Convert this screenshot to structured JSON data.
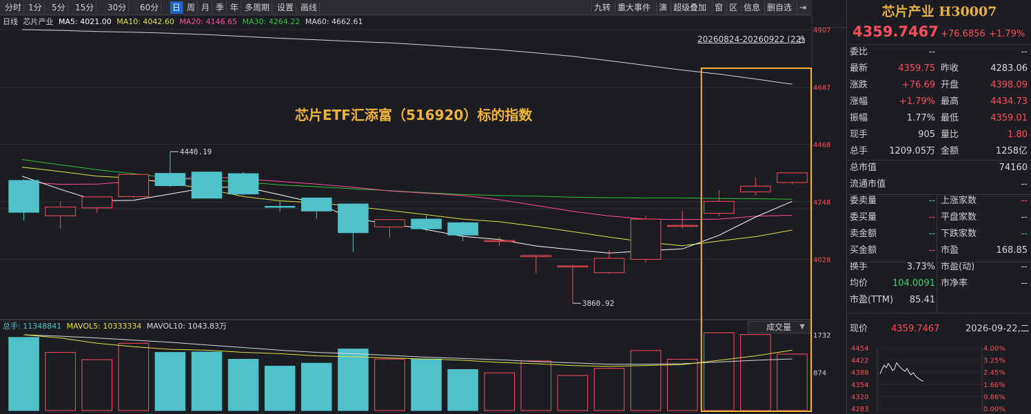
{
  "toolbar": {
    "periods": [
      "分时",
      "1分",
      "5分",
      "15分",
      "30分",
      "60分",
      "日",
      "周",
      "月",
      "季",
      "年",
      "多周期",
      "设置",
      "画线"
    ],
    "active_period": "日",
    "right_buttons": [
      "九转",
      "重大事件",
      "演",
      "超级叠加",
      "窗",
      "区",
      "信息",
      "删自选"
    ]
  },
  "indicator": {
    "period_label": "日线",
    "name": "芯片产业",
    "ma5": "MA5: 4021.00",
    "ma10": "MA10: 4042.60",
    "ma20": "MA20: 4146.65",
    "ma30": "MA30: 4264.22",
    "ma60": "MA60: 4662.61"
  },
  "volume_indicator": {
    "total": "总手: 11348841",
    "mavol5": "MAVOL5: 10333334",
    "mavol10": "MAVOL10: 1043.83万"
  },
  "volume_select": "成交量",
  "range_label": "20260824-20260922 (22)",
  "annotation": "芯片ETF汇添富（516920）标的指数",
  "price_axis": [
    "4907",
    "4687",
    "4468",
    "4248",
    "4028"
  ],
  "volume_axis": [
    "1732",
    "874"
  ],
  "marks": {
    "high": "4440.19",
    "low": "3860.92"
  },
  "colors": {
    "up": "#ff4d5a",
    "down": "#4fc1c9",
    "ma5": "#ffffff",
    "ma10": "#e5e04a",
    "ma20": "#ff4fa0",
    "ma30": "#35c23d",
    "ma60": "#d8d8d8",
    "highlight": "#f0b43a"
  },
  "chart_data": {
    "type": "candlestick",
    "ylim": [
      3800,
      4907
    ],
    "candles": [
      {
        "o": 4330,
        "h": 4335,
        "l": 4176,
        "c": 4208
      },
      {
        "o": 4195,
        "h": 4250,
        "l": 4145,
        "c": 4228
      },
      {
        "o": 4225,
        "h": 4262,
        "l": 4205,
        "c": 4267
      },
      {
        "o": 4268,
        "h": 4335,
        "l": 4262,
        "c": 4353
      },
      {
        "o": 4357,
        "h": 4440,
        "l": 4305,
        "c": 4310
      },
      {
        "o": 4362,
        "h": 4362,
        "l": 4262,
        "c": 4262
      },
      {
        "o": 4356,
        "h": 4362,
        "l": 4273,
        "c": 4278
      },
      {
        "o": 4231,
        "h": 4253,
        "l": 4211,
        "c": 4229
      },
      {
        "o": 4263,
        "h": 4263,
        "l": 4184,
        "c": 4213
      },
      {
        "o": 4240,
        "h": 4242,
        "l": 4056,
        "c": 4130
      },
      {
        "o": 4152,
        "h": 4172,
        "l": 4111,
        "c": 4180
      },
      {
        "o": 4182,
        "h": 4197,
        "l": 4136,
        "c": 4145
      },
      {
        "o": 4168,
        "h": 4172,
        "l": 4098,
        "c": 4121
      },
      {
        "o": 4098,
        "h": 4114,
        "l": 4080,
        "c": 4100
      },
      {
        "o": 4038,
        "h": 4046,
        "l": 3975,
        "c": 4043
      },
      {
        "o": 4000,
        "h": 4007,
        "l": 3860,
        "c": 4003
      },
      {
        "o": 3977,
        "h": 4063,
        "l": 3972,
        "c": 4032
      },
      {
        "o": 4028,
        "h": 4195,
        "l": 4016,
        "c": 4182
      },
      {
        "o": 4155,
        "h": 4213,
        "l": 4146,
        "c": 4158
      },
      {
        "o": 4204,
        "h": 4292,
        "l": 4193,
        "c": 4250
      },
      {
        "o": 4286,
        "h": 4340,
        "l": 4273,
        "c": 4308
      },
      {
        "o": 4322,
        "h": 4351,
        "l": 4314,
        "c": 4359
      }
    ],
    "ma5": [
      4346,
      4296,
      4252,
      4254,
      4278,
      4302,
      4306,
      4275,
      4243,
      4183,
      4165,
      4142,
      4116,
      4104,
      4079,
      4065,
      4052,
      4061,
      4068,
      4120,
      4190,
      4250
    ],
    "ma10": [
      4381,
      4364,
      4346,
      4339,
      4318,
      4298,
      4268,
      4252,
      4244,
      4231,
      4215,
      4199,
      4182,
      4172,
      4154,
      4134,
      4113,
      4094,
      4080,
      4098,
      4115,
      4140
    ],
    "ma20": [
      4325,
      4315,
      4316,
      4326,
      4333,
      4345,
      4336,
      4326,
      4316,
      4304,
      4290,
      4281,
      4272,
      4256,
      4234,
      4212,
      4194,
      4182,
      4180,
      4182,
      4193,
      4197
    ],
    "ma30": [
      4410,
      4390,
      4371,
      4356,
      4339,
      4331,
      4324,
      4313,
      4306,
      4298,
      4291,
      4283,
      4276,
      4272,
      4270,
      4266,
      4264,
      4263,
      4263,
      4261,
      4260,
      4258
    ],
    "ma60": [
      4907,
      4904,
      4900,
      4897,
      4893,
      4888,
      4881,
      4874,
      4868,
      4862,
      4856,
      4848,
      4839,
      4830,
      4818,
      4805,
      4788,
      4770,
      4752,
      4737,
      4718,
      4698
    ],
    "volume": {
      "ylim": [
        0,
        1732
      ],
      "values": [
        1672,
        1329,
        1164,
        1537,
        1329,
        1338,
        1173,
        1016,
        1083,
        1407,
        1178,
        1178,
        938,
        862,
        1135,
        801,
        964,
        1373,
        1173,
        1819,
        1737,
        1290
      ],
      "mavol5": [
        1732,
        1660,
        1540,
        1460,
        1400,
        1380,
        1330,
        1300,
        1250,
        1230,
        1200,
        1180,
        1150,
        1100,
        1070,
        1030,
        1010,
        1030,
        1050,
        1150,
        1250,
        1380
      ],
      "mavol10": [
        1732,
        1700,
        1660,
        1610,
        1560,
        1500,
        1440,
        1380,
        1330,
        1300,
        1260,
        1220,
        1190,
        1160,
        1120,
        1090,
        1060,
        1060,
        1070,
        1110,
        1150,
        1180
      ]
    },
    "highlight_from_index": 19
  },
  "quote": {
    "title": "芯片产业 H30007",
    "price": "4359.7467",
    "change": "+76.6856",
    "change_pct": "+1.79%",
    "rows": [
      {
        "l1": "委比",
        "v1": "--",
        "c1": "white",
        "l2": "",
        "v2": "--",
        "c2": "white"
      },
      {
        "l1": "最新",
        "v1": "4359.75",
        "c1": "red",
        "l2": "昨收",
        "v2": "4283.06",
        "c2": "white"
      },
      {
        "l1": "涨跌",
        "v1": "+76.69",
        "c1": "red",
        "l2": "开盘",
        "v2": "4398.09",
        "c2": "red"
      },
      {
        "l1": "涨幅",
        "v1": "+1.79%",
        "c1": "red",
        "l2": "最高",
        "v2": "4434.73",
        "c2": "red"
      },
      {
        "l1": "振幅",
        "v1": "1.77%",
        "c1": "white",
        "l2": "最低",
        "v2": "4359.01",
        "c2": "red"
      },
      {
        "l1": "现手",
        "v1": "905",
        "c1": "white",
        "l2": "量比",
        "v2": "1.80",
        "c2": "red"
      },
      {
        "l1": "总手",
        "v1": "1209.05万",
        "c1": "white",
        "l2": "金额",
        "v2": "1258亿",
        "c2": "white"
      },
      {
        "l1": "总市值",
        "v1": "",
        "c1": "white",
        "l2": "",
        "v2": "74160",
        "c2": "white"
      },
      {
        "l1": "流通市值",
        "v1": "",
        "c1": "white",
        "l2": "",
        "v2": "--",
        "c2": "white"
      },
      {
        "l1": "委卖量",
        "v1": "--",
        "c1": "cyan",
        "l2": "上涨家数",
        "v2": "--",
        "c2": "red"
      },
      {
        "l1": "委买量",
        "v1": "--",
        "c1": "red",
        "l2": "平盘家数",
        "v2": "--",
        "c2": "white"
      },
      {
        "l1": "卖金额",
        "v1": "--",
        "c1": "cyan",
        "l2": "下跌家数",
        "v2": "--",
        "c2": "green"
      },
      {
        "l1": "买金额",
        "v1": "--",
        "c1": "red",
        "l2": "市盈",
        "v2": "168.85",
        "c2": "white"
      },
      {
        "l1": "换手",
        "v1": "3.73%",
        "c1": "white",
        "l2": "市盈(动)",
        "v2": "--",
        "c2": "white"
      },
      {
        "l1": "均价",
        "v1": "104.0091",
        "c1": "green",
        "l2": "市净率",
        "v2": "--",
        "c2": "white"
      },
      {
        "l1": "市盈(TTM)",
        "v1": "85.41",
        "c1": "white",
        "l2": "",
        "v2": "",
        "c2": "white"
      }
    ],
    "bottom": {
      "label": "现价",
      "price": "4359.7467",
      "date": "2026-09-22,二",
      "price_axis": [
        "4454",
        "4422",
        "4388",
        "4354",
        "4320",
        "4283"
      ],
      "pct_axis": [
        "4.00%",
        "3.25%",
        "2.45%",
        "1.66%",
        "0.86%",
        "0.00%"
      ],
      "intraday": [
        4380,
        4395,
        4405,
        4398,
        4410,
        4402,
        4390,
        4395,
        4412,
        4404,
        4398,
        4392,
        4388,
        4396,
        4385,
        4378,
        4384,
        4376,
        4370,
        4366,
        4362,
        4360
      ]
    }
  }
}
